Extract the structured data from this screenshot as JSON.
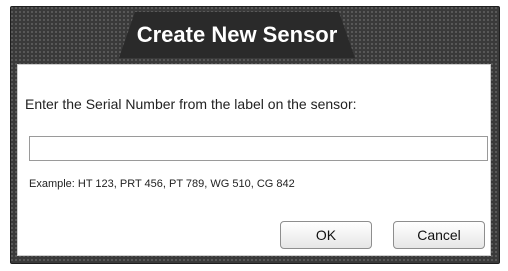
{
  "dialog": {
    "title": "Create New Sensor",
    "prompt": "Enter the Serial Number from the label on the sensor:",
    "serial_input": {
      "value": "",
      "placeholder": ""
    },
    "example": "Example: HT 123, PRT 456, PT 789, WG 510, CG 842",
    "buttons": {
      "ok_label": "OK",
      "cancel_label": "Cancel"
    }
  },
  "colors": {
    "frame": "#3a3a3a",
    "title_tab": "#2a2a2a",
    "title_text": "#ffffff",
    "panel": "#ffffff"
  }
}
